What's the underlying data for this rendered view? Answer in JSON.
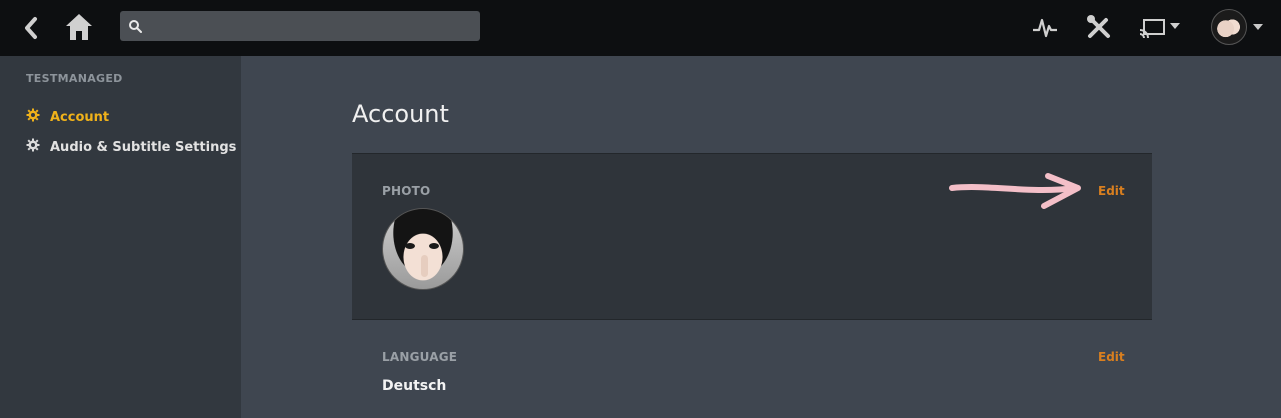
{
  "sidebar": {
    "title": "TESTMANAGED",
    "items": [
      {
        "label": "Account"
      },
      {
        "label": "Audio & Subtitle Settings"
      }
    ]
  },
  "main": {
    "title": "Account",
    "photo": {
      "label": "PHOTO",
      "edit": "Edit"
    },
    "language": {
      "label": "LANGUAGE",
      "value": "Deutsch",
      "edit": "Edit"
    }
  },
  "search": {
    "value": ""
  },
  "colors": {
    "accent": "#f0b21a",
    "edit": "#d97f1f",
    "topbar": "#0d0f11"
  }
}
